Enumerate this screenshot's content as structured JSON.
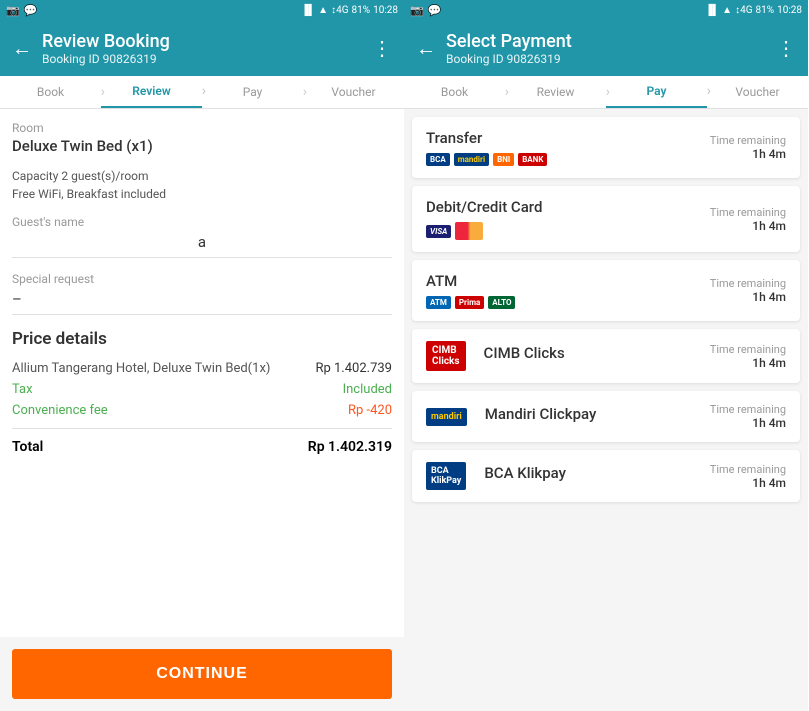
{
  "statusBar": {
    "time": "10:28",
    "battery": "81%",
    "signal": "4G"
  },
  "leftScreen": {
    "header": {
      "title": "Review Booking",
      "subtitle": "Booking ID 90826319",
      "backIcon": "←",
      "moreIcon": "⋮"
    },
    "breadcrumb": [
      "Book",
      "Review",
      "Pay",
      "Voucher"
    ],
    "activeBreadcrumb": "Review",
    "room": {
      "label": "Room",
      "value": "Deluxe Twin Bed (x1)",
      "capacity": "Capacity 2 guest(s)/room",
      "amenities": "Free WiFi, Breakfast included"
    },
    "guestName": {
      "label": "Guest's name",
      "value": "a"
    },
    "specialRequest": {
      "label": "Special request",
      "value": "–"
    },
    "priceDetails": {
      "heading": "Price details",
      "hotelLine": "Allium Tangerang Hotel, Deluxe Twin Bed(1x)",
      "hotelPrice": "Rp 1.402.739",
      "taxLabel": "Tax",
      "taxValue": "Included",
      "feeLabel": "Convenience fee",
      "feeValue": "Rp -420",
      "totalLabel": "Total",
      "totalValue": "Rp 1.402.319"
    },
    "continueButton": "CONTINUE"
  },
  "rightScreen": {
    "header": {
      "title": "Select Payment",
      "subtitle": "Booking ID 90826319",
      "backIcon": "←",
      "moreIcon": "⋮"
    },
    "breadcrumb": [
      "Book",
      "Review",
      "Pay",
      "Voucher"
    ],
    "activeBreadcrumb": "Pay",
    "paymentMethods": [
      {
        "name": "Transfer",
        "logos": [
          "BCA",
          "mandiri",
          "BNI",
          "Bank"
        ],
        "timeLabel": "Time remaining",
        "timeValue": "1h 4m",
        "type": "transfer"
      },
      {
        "name": "Debit/Credit Card",
        "logos": [
          "VISA",
          "MC"
        ],
        "timeLabel": "Time remaining",
        "timeValue": "1h 4m",
        "type": "card"
      },
      {
        "name": "ATM",
        "logos": [
          "ATM",
          "Prima",
          "ALTO"
        ],
        "timeLabel": "Time remaining",
        "timeValue": "1h 4m",
        "type": "atm"
      },
      {
        "name": "CIMB Clicks",
        "logos": [
          "CIMB"
        ],
        "timeLabel": "Time remaining",
        "timeValue": "1h 4m",
        "type": "cimb"
      },
      {
        "name": "Mandiri Clickpay",
        "logos": [
          "Mandiri"
        ],
        "timeLabel": "Time remaining",
        "timeValue": "1h 4m",
        "type": "mandiri"
      },
      {
        "name": "BCA Klikpay",
        "logos": [
          "BCA"
        ],
        "timeLabel": "Time remaining",
        "timeValue": "1h 4m",
        "type": "bca"
      }
    ]
  }
}
